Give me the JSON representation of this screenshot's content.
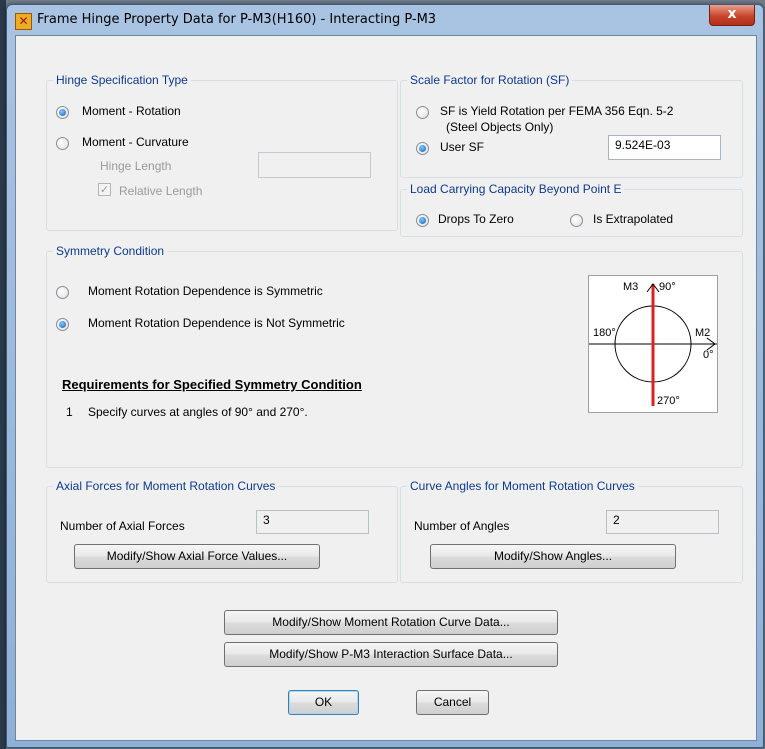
{
  "window": {
    "title": "Frame Hinge Property Data for P-M3(H160) - Interacting P-M3",
    "close_glyph": "x"
  },
  "hinge_spec": {
    "title": "Hinge Specification Type",
    "moment_rotation": "Moment - Rotation",
    "moment_curvature": "Moment - Curvature",
    "hinge_length_label": "Hinge Length",
    "hinge_length_value": "",
    "relative_length_label": "Relative Length",
    "selected": "moment_rotation"
  },
  "scale_factor": {
    "title": "Scale Factor for Rotation (SF)",
    "yield_rotation_line1": "SF is Yield Rotation per FEMA 356 Eqn. 5-2",
    "yield_rotation_line2": "(Steel Objects Only)",
    "user_sf_label": "User SF",
    "user_sf_value": "9.524E-03",
    "selected": "user_sf"
  },
  "load_capacity": {
    "title": "Load Carrying Capacity Beyond Point E",
    "drops_to_zero": "Drops To Zero",
    "is_extrapolated": "Is Extrapolated",
    "selected": "drops_to_zero"
  },
  "symmetry": {
    "title": "Symmetry Condition",
    "symmetric": "Moment Rotation Dependence is Symmetric",
    "not_symmetric": "Moment Rotation Dependence is Not Symmetric",
    "selected": "not_symmetric",
    "requirements_title": "Requirements for Specified Symmetry Condition",
    "requirement_number": "1",
    "requirement_text": "Specify curves at angles of 90° and 270°.",
    "diagram": {
      "m3_label": "M3",
      "angle_90": "90°",
      "angle_180": "180°",
      "m2_label": "M2",
      "angle_0": "0°",
      "angle_270": "270°",
      "highlight_color": "#e02020"
    }
  },
  "axial_forces": {
    "title": "Axial Forces for Moment Rotation Curves",
    "count_label": "Number of Axial Forces",
    "count_value": "3",
    "modify_button": "Modify/Show Axial Force Values..."
  },
  "curve_angles": {
    "title": "Curve Angles for Moment Rotation Curves",
    "count_label": "Number of Angles",
    "count_value": "2",
    "modify_button": "Modify/Show Angles..."
  },
  "bottom": {
    "moment_rotation_button": "Modify/Show Moment Rotation Curve Data...",
    "interaction_surface_button": "Modify/Show P-M3 Interaction Surface Data...",
    "ok": "OK",
    "cancel": "Cancel"
  }
}
